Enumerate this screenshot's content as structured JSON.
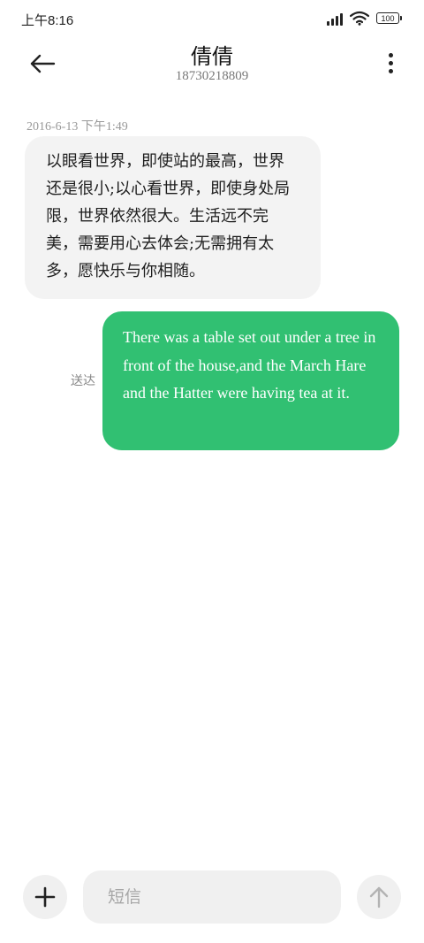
{
  "status_bar": {
    "time": "上午8:16",
    "battery_level": "100",
    "icons": [
      "signal-icon",
      "wifi-icon",
      "battery-icon"
    ]
  },
  "header": {
    "contact_name": "倩倩",
    "contact_number": "18730218809",
    "back_icon": "arrow-left-icon",
    "more_icon": "more-vertical-icon"
  },
  "conversation": {
    "timestamp": "2016-6-13 下午1:49",
    "incoming_message": "以眼看世界，即使站的最高，世界还是很小;以心看世界，即使身处局限，世界依然很大。生活远不完美，需要用心去体会;无需拥有太多，愿快乐与你相随。",
    "outgoing_message": "There was a table set out under a tree in front of the house,and the March Hare and the Hatter were having tea at it.",
    "delivered_status": "送达"
  },
  "input_bar": {
    "placeholder": "短信",
    "value": "",
    "add_icon": "plus-icon",
    "send_icon": "arrow-up-icon"
  },
  "colors": {
    "outgoing_bubble": "#31c072",
    "incoming_bubble": "#f3f3f3",
    "input_background": "#f0f0f0"
  }
}
